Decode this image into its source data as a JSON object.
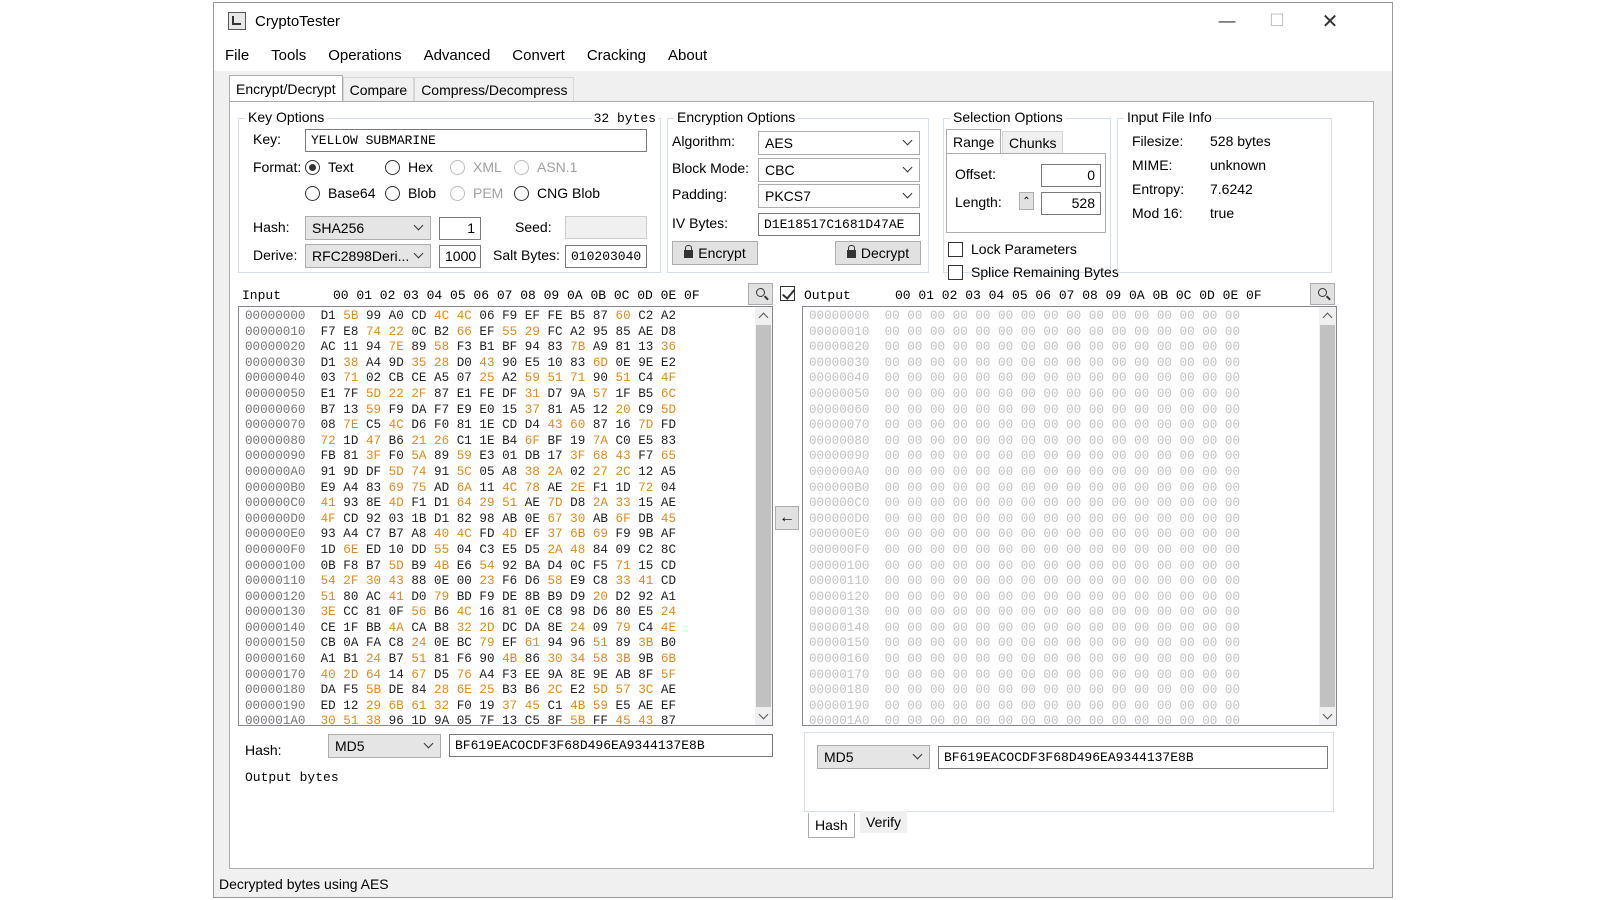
{
  "window": {
    "title": "CryptoTester"
  },
  "menu": [
    "File",
    "Tools",
    "Operations",
    "Advanced",
    "Convert",
    "Cracking",
    "About"
  ],
  "tabs": [
    "Encrypt/Decrypt",
    "Compare",
    "Compress/Decompress"
  ],
  "key_options": {
    "title": "Key Options",
    "bytes": "32 bytes",
    "key_label": "Key:",
    "key_value": "YELLOW SUBMARINE",
    "format_label": "Format:",
    "formats": [
      "Text",
      "Hex",
      "XML",
      "ASN.1",
      "Base64",
      "Blob",
      "PEM",
      "CNG Blob"
    ],
    "selected_format": "Text",
    "hash_label": "Hash:",
    "hash_value": "SHA256",
    "hash_iter": "1",
    "seed_label": "Seed:",
    "derive_label": "Derive:",
    "derive_value": "RFC2898Deri...",
    "derive_iter": "1000",
    "salt_label": "Salt Bytes:",
    "salt_value": "010203040"
  },
  "encryption_options": {
    "title": "Encryption Options",
    "algorithm_label": "Algorithm:",
    "algorithm": "AES",
    "block_mode_label": "Block Mode:",
    "block_mode": "CBC",
    "padding_label": "Padding:",
    "padding": "PKCS7",
    "iv_label": "IV Bytes:",
    "iv_value": "D1E18517C1681D47AE",
    "encrypt_label": "Encrypt",
    "decrypt_label": "Decrypt"
  },
  "selection_options": {
    "title": "Selection Options",
    "tab_range": "Range",
    "tab_chunks": "Chunks",
    "offset_label": "Offset:",
    "offset": "0",
    "length_label": "Length:",
    "length": "528",
    "lock_label": "Lock Parameters",
    "splice_label": "Splice Remaining Bytes"
  },
  "file_info": {
    "title": "Input File Info",
    "filesize_label": "Filesize:",
    "filesize": "528 bytes",
    "mime_label": "MIME:",
    "mime": "unknown",
    "entropy_label": "Entropy:",
    "entropy": "7.6242",
    "mod16_label": "Mod 16:",
    "mod16": "true"
  },
  "input_panel": {
    "title": "Input",
    "columns": "00 01 02 03 04 05 06 07 08 09 0A 0B 0C 0D 0E 0F",
    "rows": [
      {
        "off": "00000000",
        "bytes": [
          "D1",
          "5B",
          "99",
          "A0",
          "CD",
          "4C",
          "4C",
          "06",
          "F9",
          "EF",
          "FE",
          "B5",
          "87",
          "60",
          "C2",
          "A2"
        ]
      },
      {
        "off": "00000010",
        "bytes": [
          "F7",
          "E8",
          "74",
          "22",
          "0C",
          "B2",
          "66",
          "EF",
          "55",
          "29",
          "FC",
          "A2",
          "95",
          "85",
          "AE",
          "D8"
        ]
      },
      {
        "off": "00000020",
        "bytes": [
          "AC",
          "11",
          "94",
          "7E",
          "89",
          "58",
          "F3",
          "B1",
          "BF",
          "94",
          "83",
          "7B",
          "A9",
          "81",
          "13",
          "36"
        ]
      },
      {
        "off": "00000030",
        "bytes": [
          "D1",
          "38",
          "A4",
          "9D",
          "35",
          "28",
          "D0",
          "43",
          "90",
          "E5",
          "10",
          "83",
          "6D",
          "0E",
          "9E",
          "E2"
        ]
      },
      {
        "off": "00000040",
        "bytes": [
          "03",
          "71",
          "02",
          "CB",
          "CE",
          "A5",
          "07",
          "25",
          "A2",
          "59",
          "51",
          "71",
          "90",
          "51",
          "C4",
          "4F"
        ]
      },
      {
        "off": "00000050",
        "bytes": [
          "E1",
          "7F",
          "5D",
          "22",
          "2F",
          "87",
          "E1",
          "FE",
          "DF",
          "31",
          "D7",
          "9A",
          "57",
          "1F",
          "B5",
          "6C"
        ]
      },
      {
        "off": "00000060",
        "bytes": [
          "B7",
          "13",
          "59",
          "F9",
          "DA",
          "F7",
          "E9",
          "E0",
          "15",
          "37",
          "81",
          "A5",
          "12",
          "20",
          "C9",
          "5D"
        ]
      },
      {
        "off": "00000070",
        "bytes": [
          "08",
          "7E",
          "C5",
          "4C",
          "D6",
          "F0",
          "81",
          "1E",
          "CD",
          "D4",
          "43",
          "60",
          "87",
          "16",
          "7D",
          "FD"
        ]
      },
      {
        "off": "00000080",
        "bytes": [
          "72",
          "1D",
          "47",
          "B6",
          "21",
          "26",
          "C1",
          "1E",
          "B4",
          "6F",
          "BF",
          "19",
          "7A",
          "C0",
          "E5",
          "83"
        ]
      },
      {
        "off": "00000090",
        "bytes": [
          "FB",
          "81",
          "3F",
          "F0",
          "5A",
          "89",
          "59",
          "E3",
          "01",
          "DB",
          "17",
          "3F",
          "68",
          "43",
          "F7",
          "65"
        ]
      },
      {
        "off": "000000A0",
        "bytes": [
          "91",
          "9D",
          "DF",
          "5D",
          "74",
          "91",
          "5C",
          "05",
          "A8",
          "38",
          "2A",
          "02",
          "27",
          "2C",
          "12",
          "A5"
        ]
      },
      {
        "off": "000000B0",
        "bytes": [
          "E9",
          "A4",
          "83",
          "69",
          "75",
          "AD",
          "6A",
          "11",
          "4C",
          "78",
          "AE",
          "2E",
          "F1",
          "1D",
          "72",
          "04"
        ]
      },
      {
        "off": "000000C0",
        "bytes": [
          "41",
          "93",
          "8E",
          "4D",
          "F1",
          "D1",
          "64",
          "29",
          "51",
          "AE",
          "7D",
          "D8",
          "2A",
          "33",
          "15",
          "AE"
        ]
      },
      {
        "off": "000000D0",
        "bytes": [
          "4F",
          "CD",
          "92",
          "03",
          "1B",
          "D1",
          "82",
          "98",
          "AB",
          "0E",
          "67",
          "30",
          "AB",
          "6F",
          "DB",
          "45"
        ]
      },
      {
        "off": "000000E0",
        "bytes": [
          "93",
          "A4",
          "C7",
          "B7",
          "A8",
          "40",
          "4C",
          "FD",
          "4D",
          "EF",
          "37",
          "6B",
          "69",
          "F9",
          "9B",
          "AF"
        ]
      },
      {
        "off": "000000F0",
        "bytes": [
          "1D",
          "6E",
          "ED",
          "10",
          "DD",
          "55",
          "04",
          "C3",
          "E5",
          "D5",
          "2A",
          "48",
          "84",
          "09",
          "C2",
          "8C"
        ]
      },
      {
        "off": "00000100",
        "bytes": [
          "0B",
          "F8",
          "B7",
          "5D",
          "B9",
          "4B",
          "E6",
          "54",
          "92",
          "BA",
          "D4",
          "0C",
          "F5",
          "71",
          "15",
          "CD"
        ]
      },
      {
        "off": "00000110",
        "bytes": [
          "54",
          "2F",
          "30",
          "43",
          "88",
          "0E",
          "00",
          "23",
          "F6",
          "D6",
          "58",
          "E9",
          "C8",
          "33",
          "41",
          "CD"
        ]
      },
      {
        "off": "00000120",
        "bytes": [
          "51",
          "80",
          "AC",
          "41",
          "D0",
          "79",
          "BD",
          "F9",
          "DE",
          "8B",
          "B9",
          "D9",
          "20",
          "D2",
          "92",
          "A1"
        ]
      },
      {
        "off": "00000130",
        "bytes": [
          "3E",
          "CC",
          "81",
          "0F",
          "56",
          "B6",
          "4C",
          "16",
          "81",
          "0E",
          "C8",
          "98",
          "D6",
          "80",
          "E5",
          "24"
        ]
      },
      {
        "off": "00000140",
        "bytes": [
          "CE",
          "1F",
          "BB",
          "4A",
          "CA",
          "B8",
          "32",
          "2D",
          "DC",
          "DA",
          "8E",
          "24",
          "09",
          "79",
          "C4",
          "4E"
        ]
      },
      {
        "off": "00000150",
        "bytes": [
          "CB",
          "0A",
          "FA",
          "C8",
          "24",
          "0E",
          "BC",
          "79",
          "EF",
          "61",
          "94",
          "96",
          "51",
          "89",
          "3B",
          "B0"
        ]
      },
      {
        "off": "00000160",
        "bytes": [
          "A1",
          "B1",
          "24",
          "B7",
          "51",
          "81",
          "F6",
          "90",
          "4B",
          "86",
          "30",
          "34",
          "58",
          "3B",
          "9B",
          "6B"
        ]
      },
      {
        "off": "00000170",
        "bytes": [
          "40",
          "2D",
          "64",
          "14",
          "67",
          "D5",
          "76",
          "A4",
          "F3",
          "EE",
          "9A",
          "8E",
          "9E",
          "AB",
          "8F",
          "5F"
        ]
      },
      {
        "off": "00000180",
        "bytes": [
          "DA",
          "F5",
          "5B",
          "DE",
          "84",
          "28",
          "6E",
          "25",
          "B3",
          "B6",
          "2C",
          "E2",
          "5D",
          "57",
          "3C",
          "AE"
        ]
      },
      {
        "off": "00000190",
        "bytes": [
          "ED",
          "12",
          "29",
          "6B",
          "61",
          "32",
          "F0",
          "19",
          "37",
          "45",
          "C1",
          "4B",
          "59",
          "E5",
          "AE",
          "EF"
        ]
      },
      {
        "off": "000001A0",
        "bytes": [
          "30",
          "51",
          "38",
          "96",
          "1D",
          "9A",
          "05",
          "7F",
          "13",
          "C5",
          "8F",
          "5B",
          "FF",
          "45",
          "43",
          "87"
        ]
      }
    ],
    "hash_label": "Hash:",
    "hash_algo": "MD5",
    "hash_value": "BF619EACOCDF3F68D496EA9344137E8B",
    "output_bytes_label": "Output bytes"
  },
  "output_panel": {
    "title": "Output",
    "columns": "00 01 02 03 04 05 06 07 08 09 0A 0B 0C 0D 0E 0F",
    "offsets": [
      "00000000",
      "00000010",
      "00000020",
      "00000030",
      "00000040",
      "00000050",
      "00000060",
      "00000070",
      "00000080",
      "00000090",
      "000000A0",
      "000000B0",
      "000000C0",
      "000000D0",
      "000000E0",
      "000000F0",
      "00000100",
      "00000110",
      "00000120",
      "00000130",
      "00000140",
      "00000150",
      "00000160",
      "00000170",
      "00000180",
      "00000190",
      "000001A0"
    ],
    "fill_byte": "00",
    "hash_algo": "MD5",
    "hash_value": "BF619EACOCDF3F68D496EA9344137E8B",
    "tab_hash": "Hash",
    "tab_verify": "Verify"
  },
  "status": "Decrypted bytes using AES"
}
